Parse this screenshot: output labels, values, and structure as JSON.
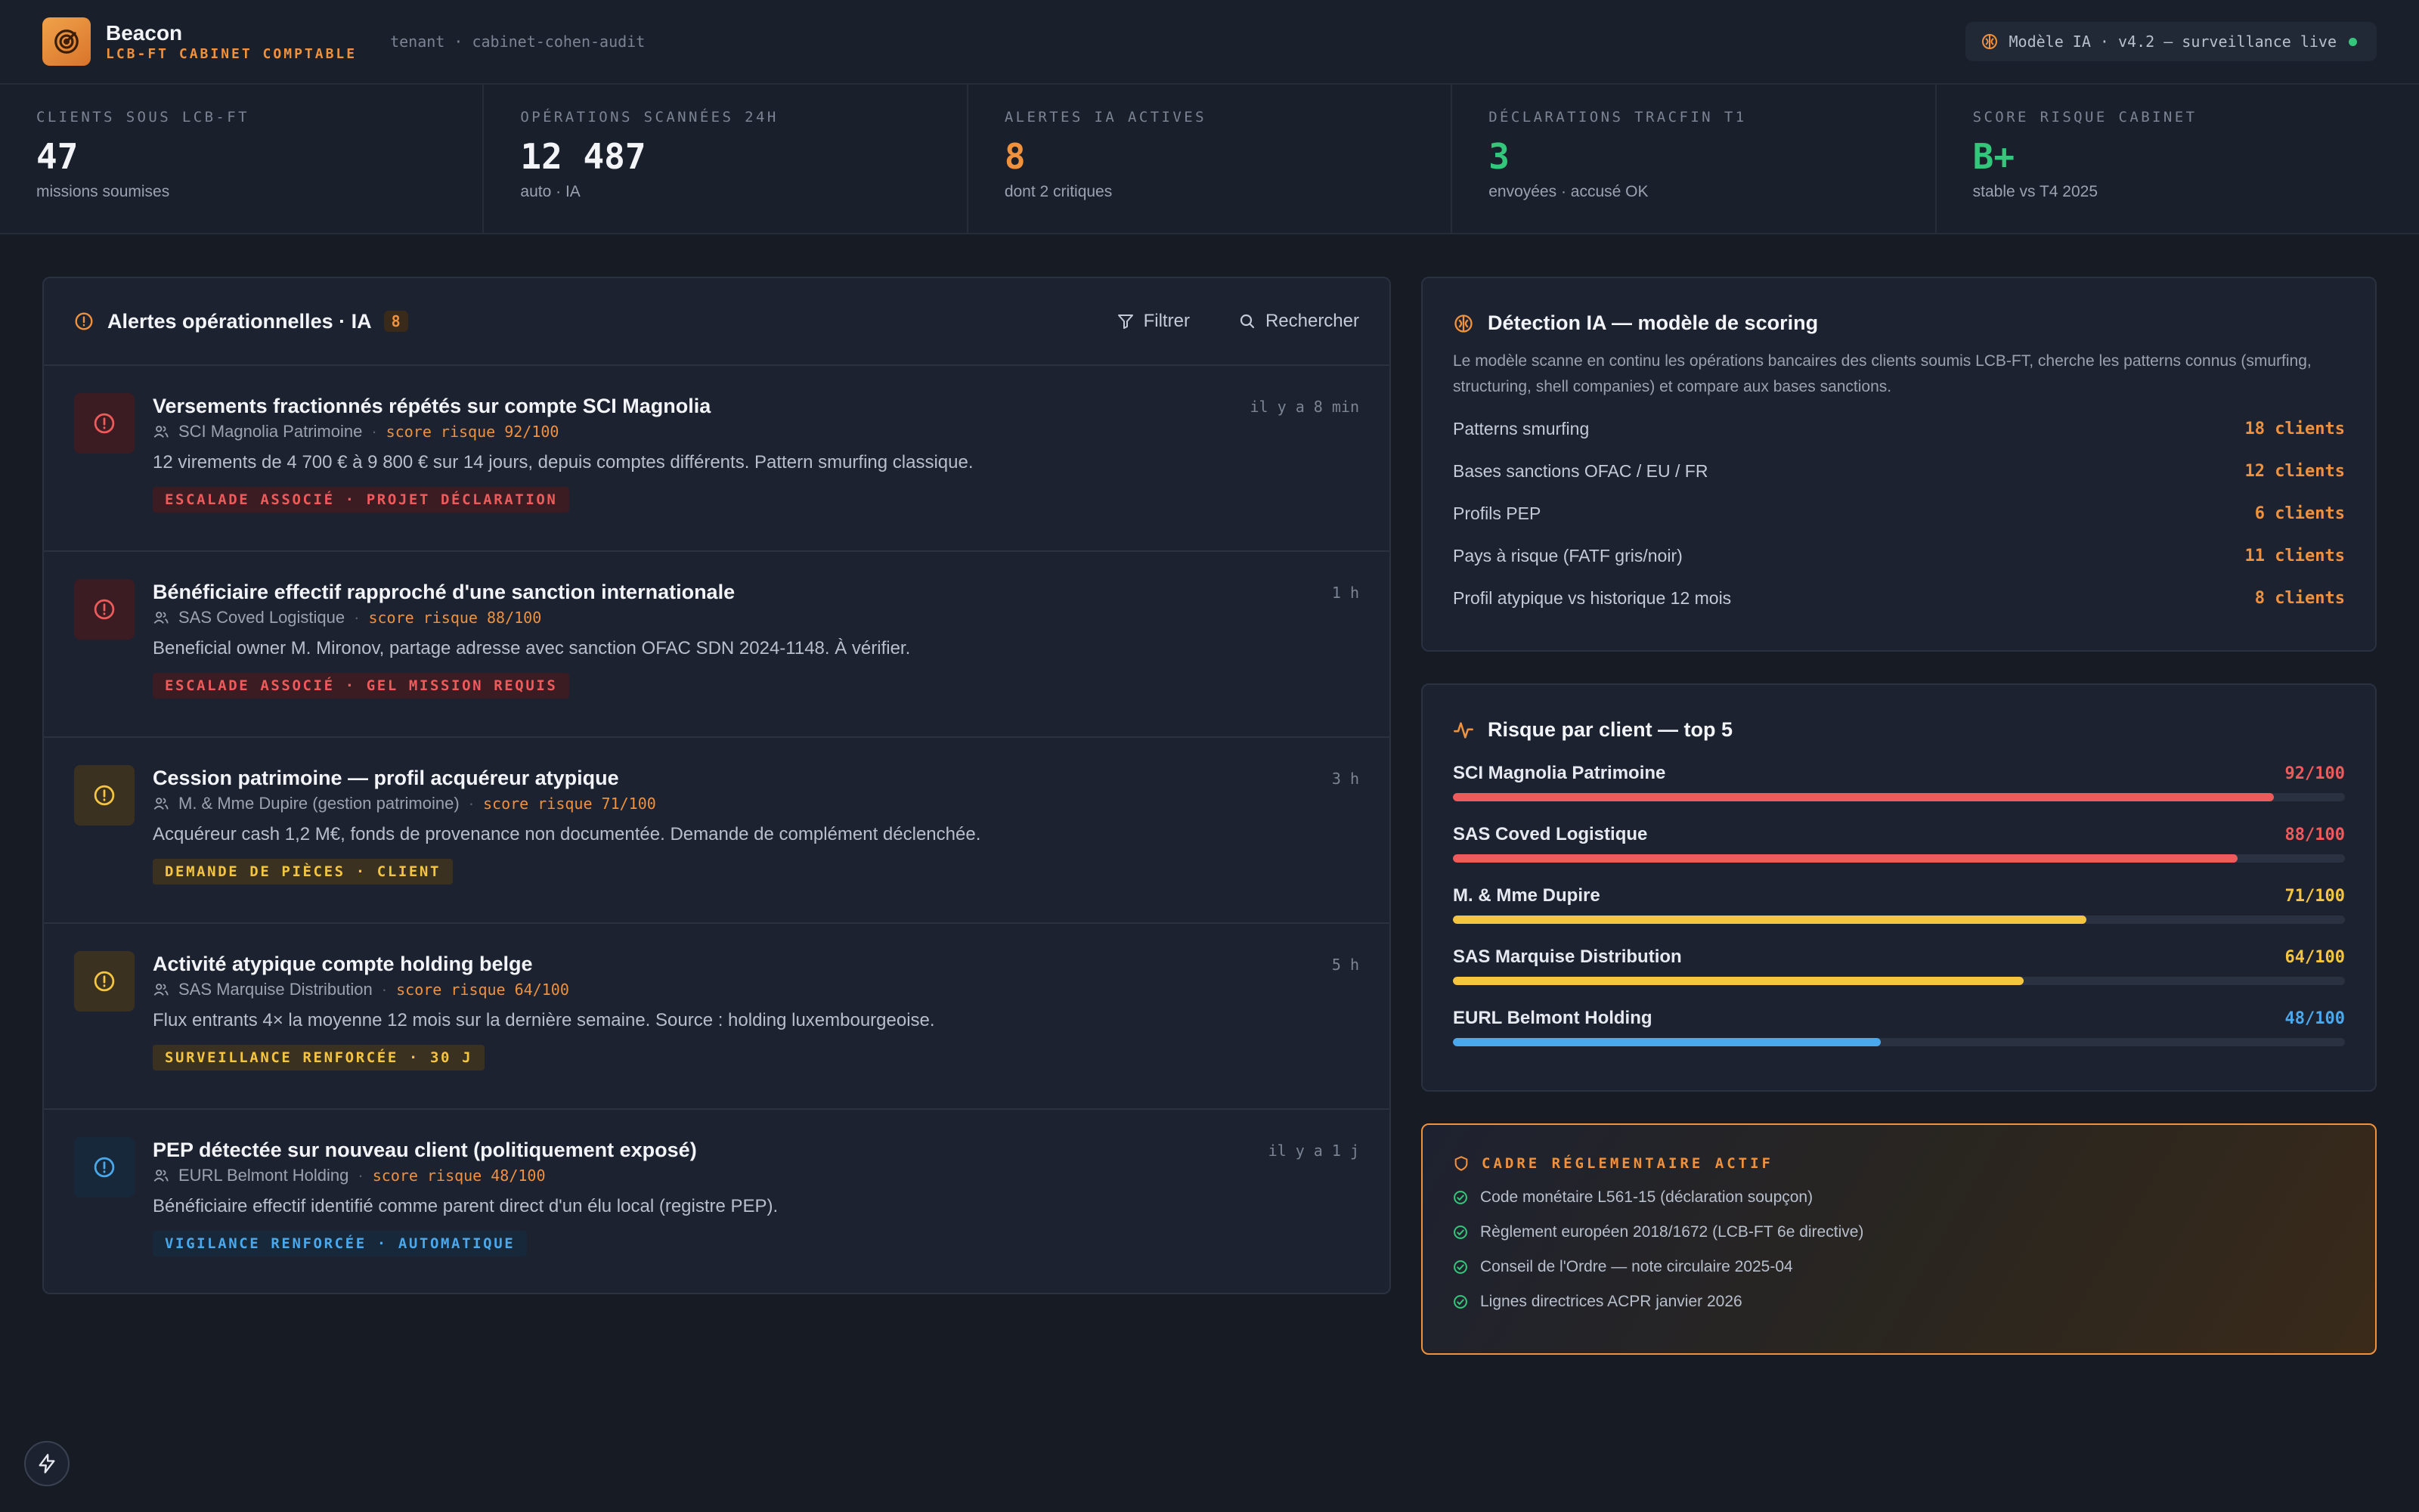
{
  "app": {
    "name": "Beacon",
    "subtitle": "LCB-FT CABINET COMPTABLE",
    "tenant": "tenant · cabinet-cohen-audit",
    "model_status": "Modèle IA · v4.2 — surveillance live"
  },
  "kpis": [
    {
      "label": "CLIENTS SOUS LCB-FT",
      "value": "47",
      "sub": "missions soumises",
      "color": "#f2f4f8"
    },
    {
      "label": "OPÉRATIONS SCANNÉES 24H",
      "value": "12 487",
      "sub": "auto · IA",
      "color": "#f2f4f8"
    },
    {
      "label": "ALERTES IA ACTIVES",
      "value": "8",
      "sub": "dont 2 critiques",
      "color": "#f0913d"
    },
    {
      "label": "DÉCLARATIONS TRACFIN T1",
      "value": "3",
      "sub": "envoyées · accusé OK",
      "color": "#34c77b"
    },
    {
      "label": "SCORE RISQUE CABINET",
      "value": "B+",
      "sub": "stable vs T4 2025",
      "color": "#34c77b"
    }
  ],
  "alerts_panel": {
    "title": "Alertes opérationnelles · IA",
    "count": "8",
    "filter_label": "Filtrer",
    "search_label": "Rechercher"
  },
  "alerts": [
    {
      "title": "Versements fractionnés répétés sur compte SCI Magnolia",
      "client": "SCI Magnolia Patrimoine",
      "score": "score risque 92/100",
      "desc": "12 virements de 4 700 € à 9 800 € sur 14 jours, depuis comptes différents. Pattern smurfing classique.",
      "tag": "ESCALADE ASSOCIÉ · PROJET DÉCLARATION",
      "time": "il y a 8 min",
      "severity": "red"
    },
    {
      "title": "Bénéficiaire effectif rapproché d'une sanction internationale",
      "client": "SAS Coved Logistique",
      "score": "score risque 88/100",
      "desc": "Beneficial owner M. Mironov, partage adresse avec sanction OFAC SDN 2024-1148. À vérifier.",
      "tag": "ESCALADE ASSOCIÉ · GEL MISSION REQUIS",
      "time": "1 h",
      "severity": "red"
    },
    {
      "title": "Cession patrimoine — profil acquéreur atypique",
      "client": "M. & Mme Dupire (gestion patrimoine)",
      "score": "score risque 71/100",
      "desc": "Acquéreur cash 1,2 M€, fonds de provenance non documentée. Demande de complément déclenchée.",
      "tag": "DEMANDE DE PIÈCES · CLIENT",
      "time": "3 h",
      "severity": "yellow"
    },
    {
      "title": "Activité atypique compte holding belge",
      "client": "SAS Marquise Distribution",
      "score": "score risque 64/100",
      "desc": "Flux entrants 4× la moyenne 12 mois sur la dernière semaine. Source : holding luxembourgeoise.",
      "tag": "SURVEILLANCE RENFORCÉE · 30 J",
      "time": "5 h",
      "severity": "yellow"
    },
    {
      "title": "PEP détectée sur nouveau client (politiquement exposé)",
      "client": "EURL Belmont Holding",
      "score": "score risque 48/100",
      "desc": "Bénéficiaire effectif identifié comme parent direct d'un élu local (registre PEP).",
      "tag": "VIGILANCE RENFORCÉE · AUTOMATIQUE",
      "time": "il y a 1 j",
      "severity": "blue"
    }
  ],
  "detection": {
    "title": "Détection IA — modèle de scoring",
    "desc": "Le modèle scanne en continu les opérations bancaires des clients soumis LCB-FT, cherche les patterns connus (smurfing, structuring, shell companies) et compare aux bases sanctions.",
    "rows": [
      {
        "label": "Patterns smurfing",
        "value": "18 clients"
      },
      {
        "label": "Bases sanctions OFAC / EU / FR",
        "value": "12 clients"
      },
      {
        "label": "Profils PEP",
        "value": "6 clients"
      },
      {
        "label": "Pays à risque (FATF gris/noir)",
        "value": "11 clients"
      },
      {
        "label": "Profil atypique vs historique 12 mois",
        "value": "8 clients"
      }
    ]
  },
  "risk": {
    "title": "Risque par client — top 5",
    "rows": [
      {
        "name": "SCI Magnolia Patrimoine",
        "score": "92/100",
        "pct": 92,
        "color": "#ef5a5a"
      },
      {
        "name": "SAS Coved Logistique",
        "score": "88/100",
        "pct": 88,
        "color": "#ef5a5a"
      },
      {
        "name": "M. & Mme Dupire",
        "score": "71/100",
        "pct": 71,
        "color": "#f5c542"
      },
      {
        "name": "SAS Marquise Distribution",
        "score": "64/100",
        "pct": 64,
        "color": "#f5c542"
      },
      {
        "name": "EURL Belmont Holding",
        "score": "48/100",
        "pct": 48,
        "color": "#4aa8ec"
      }
    ]
  },
  "regl": {
    "title": "CADRE RÉGLEMENTAIRE ACTIF",
    "items": [
      "Code monétaire L561-15 (déclaration soupçon)",
      "Règlement européen 2018/1672 (LCB-FT 6e directive)",
      "Conseil de l'Ordre — note circulaire 2025-04",
      "Lignes directrices ACPR janvier 2026"
    ]
  },
  "colors": {
    "accent": "#f0913d",
    "danger": "#ef5a5a",
    "warning": "#f5c542",
    "info": "#4aa8ec",
    "success": "#34c77b"
  }
}
